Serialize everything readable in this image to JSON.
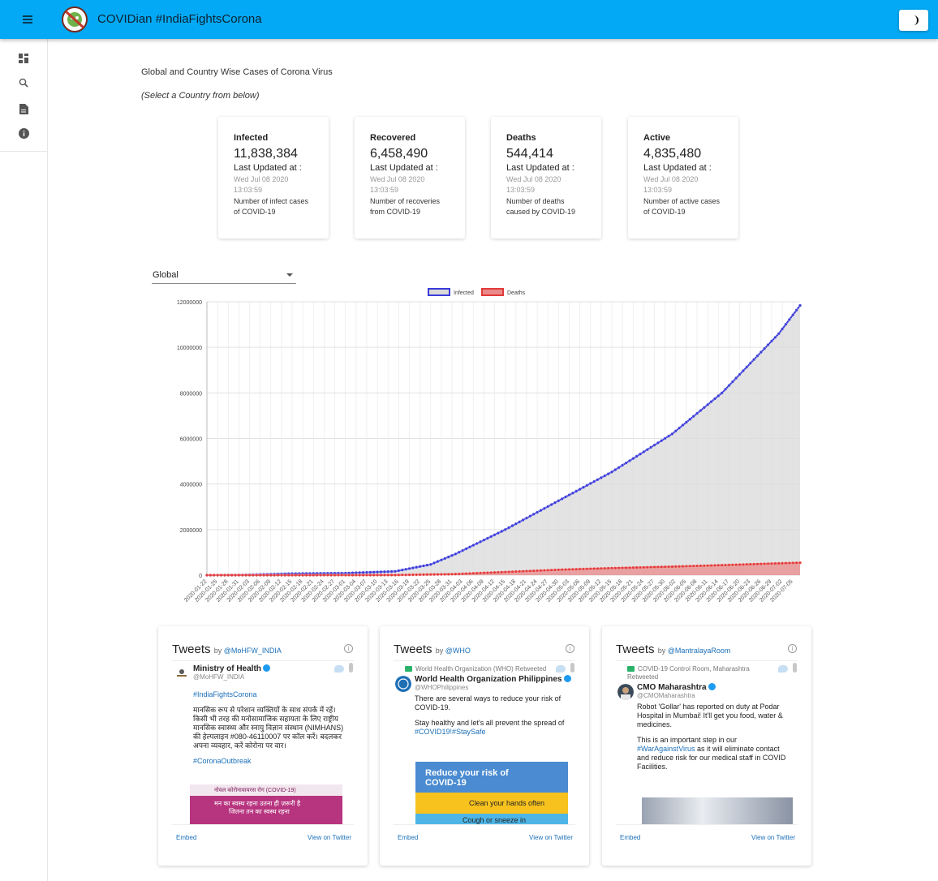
{
  "app": {
    "title": "COVIDian #IndiaFightsCorona"
  },
  "nav": {
    "items": [
      "dashboard-icon",
      "search-icon",
      "document-icon",
      "info-icon"
    ]
  },
  "page": {
    "heading": "Global and Country Wise Cases of Corona Virus",
    "subheading": "(Select a Country from below)"
  },
  "cards": [
    {
      "title": "Infected",
      "value": "11,838,384",
      "updated_label": "Last Updated at :",
      "updated_at": "Wed Jul 08 2020 13:03:59",
      "description": "Number of infect cases of COVID-19"
    },
    {
      "title": "Recovered",
      "value": "6,458,490",
      "updated_label": "Last Updated at :",
      "updated_at": "Wed Jul 08 2020 13:03:59",
      "description": "Number of recoveries from COVID-19"
    },
    {
      "title": "Deaths",
      "value": "544,414",
      "updated_label": "Last Updated at :",
      "updated_at": "Wed Jul 08 2020 13:03:59",
      "description": "Number of deaths caused by COVID-19"
    },
    {
      "title": "Active",
      "value": "4,835,480",
      "updated_label": "Last Updated at :",
      "updated_at": "Wed Jul 08 2020 13:03:59",
      "description": "Number of active cases of COVID-19"
    }
  ],
  "country_select": {
    "value": "Global"
  },
  "chart_data": {
    "type": "line",
    "title": "",
    "xlabel": "",
    "ylabel": "",
    "ylim": [
      0,
      12000000
    ],
    "y_ticks": [
      "0",
      "2000000",
      "4000000",
      "6000000",
      "8000000",
      "10000000",
      "12000000"
    ],
    "x_start": "2020-01-22",
    "x_end": "2020-07-07",
    "x_tick_labels": [
      "2020-01-22",
      "2020-01-25",
      "2020-01-28",
      "2020-01-31",
      "2020-02-03",
      "2020-02-06",
      "2020-02-09",
      "2020-02-12",
      "2020-02-15",
      "2020-02-18",
      "2020-02-21",
      "2020-02-24",
      "2020-02-27",
      "2020-03-01",
      "2020-03-04",
      "2020-03-07",
      "2020-03-10",
      "2020-03-13",
      "2020-03-16",
      "2020-03-19",
      "2020-03-22",
      "2020-03-25",
      "2020-03-28",
      "2020-03-31",
      "2020-04-03",
      "2020-04-06",
      "2020-04-09",
      "2020-04-12",
      "2020-04-15",
      "2020-04-18",
      "2020-04-21",
      "2020-04-24",
      "2020-04-27",
      "2020-04-30",
      "2020-05-03",
      "2020-05-06",
      "2020-05-09",
      "2020-05-12",
      "2020-05-15",
      "2020-05-18",
      "2020-05-21",
      "2020-05-24",
      "2020-05-27",
      "2020-05-30",
      "2020-06-02",
      "2020-06-05",
      "2020-06-08",
      "2020-06-11",
      "2020-06-14",
      "2020-06-17",
      "2020-06-20",
      "2020-06-23",
      "2020-06-26",
      "2020-06-29",
      "2020-07-02",
      "2020-07-05"
    ],
    "grid": true,
    "legend": "top-center",
    "series": [
      {
        "name": "Infected",
        "color": "#3b3bd9",
        "fill": "#d9d9d9",
        "x": [
          "2020-01-22",
          "2020-02-01",
          "2020-02-15",
          "2020-03-01",
          "2020-03-15",
          "2020-03-25",
          "2020-04-01",
          "2020-04-15",
          "2020-05-01",
          "2020-05-15",
          "2020-06-01",
          "2020-06-15",
          "2020-07-01",
          "2020-07-07"
        ],
        "values": [
          555,
          12000,
          69000,
          88000,
          167000,
          470000,
          930000,
          2000000,
          3350000,
          4530000,
          6200000,
          8000000,
          10600000,
          11838384
        ]
      },
      {
        "name": "Deaths",
        "color": "#e23b3b",
        "fill": "#ea8a8a",
        "x": [
          "2020-01-22",
          "2020-02-15",
          "2020-03-01",
          "2020-03-15",
          "2020-04-01",
          "2020-04-15",
          "2020-05-01",
          "2020-05-15",
          "2020-06-01",
          "2020-06-15",
          "2020-07-01",
          "2020-07-07"
        ],
        "values": [
          17,
          1700,
          3000,
          6500,
          47000,
          137000,
          241000,
          308000,
          373000,
          437000,
          518000,
          544414
        ]
      }
    ]
  },
  "tweets": [
    {
      "header": "Tweets",
      "by": "by",
      "handle_link": "@MoHFW_INDIA",
      "retweet_label": "",
      "author_name": "Ministry of Health",
      "author_handle": "@MoHFW_INDIA",
      "lines": [
        "#IndiaFightsCorona",
        "मानसिक रूप से परेशान व्यक्तियों के साथ संपर्क में रहें। किसी भी तरह की मनोसामाजिक सहायता के लिए राष्ट्रीय मानसिक स्वास्थ्य और स्नायु विज्ञान संस्थान (NIMHANS) की हेल्पलाइन #080-46110007 पर कॉल करें। बदलकर अपना व्यवहार, करें कोरोना पर वार।",
        "#CoronaOutbreak"
      ],
      "media": {
        "top": "नोवल कोरोनावायरस रोग (COVID-19)",
        "line1": "मन का स्वस्थ रहना उतना ही ज़रूरी है",
        "line2": "जितना तन का स्वस्थ रहना"
      },
      "embed": "Embed",
      "view": "View on Twitter"
    },
    {
      "header": "Tweets",
      "by": "by",
      "handle_link": "@WHO",
      "retweet_label": "World Health Organization (WHO) Retweeted",
      "author_name": "World Health Organization Philippines",
      "author_handle": "@WHOPhilippines",
      "lines": [
        "There are several ways to reduce your risk of COVID-19.",
        "Stay healthy and let's all prevent the spread of",
        "#COVID19!#StaySafe"
      ],
      "media": {
        "title": "Reduce your risk of COVID-19",
        "strip": "Clean your hands often",
        "strip2": "Cough or sneeze in"
      },
      "embed": "Embed",
      "view": "View on Twitter"
    },
    {
      "header": "Tweets",
      "by": "by",
      "handle_link": "@MantralayaRoom",
      "retweet_label": "COVID-19 Control Room, Maharashtra Retweeted",
      "author_name": "CMO Maharashtra",
      "author_handle": "@CMOMaharashtra",
      "lines": [
        "Robot 'Gollar' has reported on duty at Podar Hospital in Mumbai! It'll get you food, water & medicines.",
        "This is an important step in our",
        "#WarAgainstVirus",
        "as it will eliminate contact and reduce risk for our medical staff in COVID Facilities."
      ],
      "embed": "Embed",
      "view": "View on Twitter"
    }
  ]
}
